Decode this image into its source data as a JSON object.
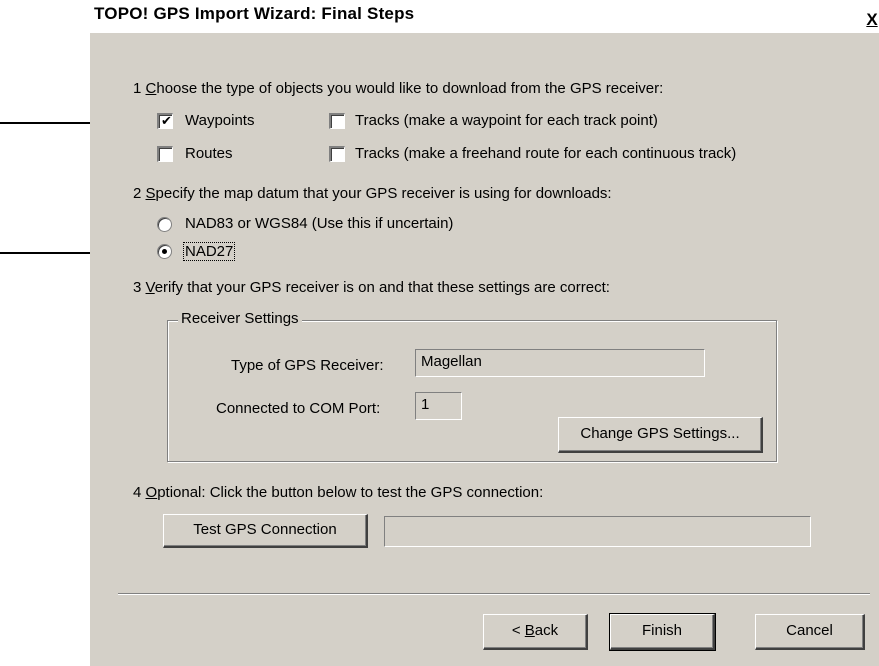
{
  "window": {
    "title": "TOPO! GPS Import Wizard: Final Steps",
    "close_label": "X"
  },
  "step1": {
    "number": "1",
    "text_first": "C",
    "text_rest": "hoose the type of objects you would like to download from the GPS receiver:",
    "options": [
      {
        "label": "Waypoints",
        "checked": true
      },
      {
        "label": "Tracks (make a waypoint for each track point)",
        "checked": false
      },
      {
        "label": "Routes",
        "checked": false
      },
      {
        "label": "Tracks (make a freehand route for each continuous track)",
        "checked": false
      }
    ]
  },
  "step2": {
    "number": "2",
    "text_first": "S",
    "text_rest": "pecify the map datum that your GPS receiver is using for downloads:",
    "options": [
      {
        "label": "NAD83 or WGS84 (Use this if uncertain)",
        "selected": false
      },
      {
        "label": "NAD27",
        "selected": true
      }
    ]
  },
  "step3": {
    "number": "3",
    "text_first": "V",
    "text_rest": "erify that your GPS receiver is on and that these settings are correct:",
    "group_title": "Receiver Settings",
    "receiver_label": "Type of GPS Receiver:",
    "receiver_value": "Magellan",
    "port_label": "Connected to COM Port:",
    "port_value": "1",
    "change_button": "Change GPS Settings..."
  },
  "step4": {
    "number": "4",
    "text_first": "O",
    "text_rest": "ptional: Click the button below to test the GPS connection:",
    "test_button": "Test GPS Connection",
    "status_value": ""
  },
  "footer": {
    "back_prefix": "< ",
    "back_accel": "B",
    "back_rest": "ack",
    "finish": "Finish",
    "cancel": "Cancel"
  }
}
